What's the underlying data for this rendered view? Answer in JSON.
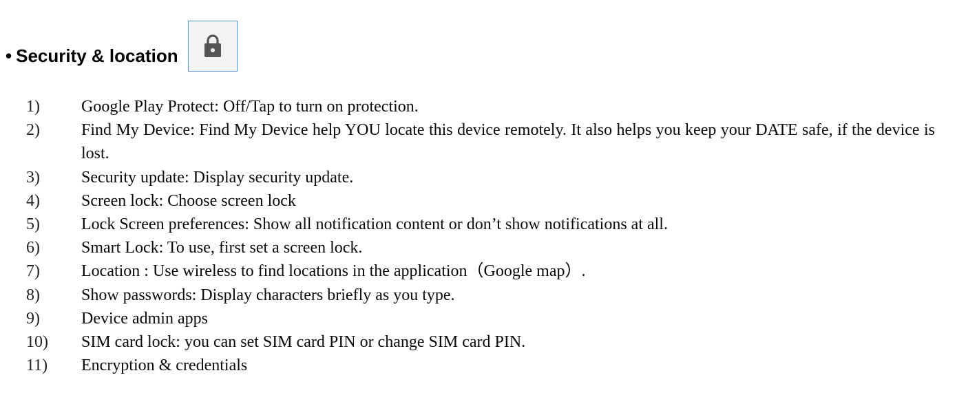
{
  "section": {
    "bullet": "•",
    "title": "Security & location",
    "icon": "lock-icon",
    "icon_color": "#555555",
    "icon_border_color": "#5b8fd6"
  },
  "items": [
    {
      "number": "1)",
      "text": "Google Play Protect: Off/Tap to turn on protection."
    },
    {
      "number": "2)",
      "text": "Find My Device: Find My Device help YOU locate this device remotely. It also helps you keep your DATE safe, if the device is lost."
    },
    {
      "number": "3)",
      "text": "Security update: Display security update."
    },
    {
      "number": "4)",
      "text": "Screen lock: Choose screen lock"
    },
    {
      "number": "5)",
      "text": "Lock Screen preferences: Show all notification content or don’t show notifications at all."
    },
    {
      "number": "6)",
      "text": "Smart Lock: To use, first set a screen lock."
    },
    {
      "number": "7)",
      "text": "Location : Use wireless to find locations in the application（Google map）."
    },
    {
      "number": "8)",
      "text": "Show passwords: Display characters briefly as you type."
    },
    {
      "number": "9)",
      "text": "Device admin apps"
    },
    {
      "number": "10)",
      "text": "SIM card lock: you can set SIM card PIN or change SIM card PIN."
    },
    {
      "number": "11)",
      "text": "Encryption & credentials"
    }
  ]
}
